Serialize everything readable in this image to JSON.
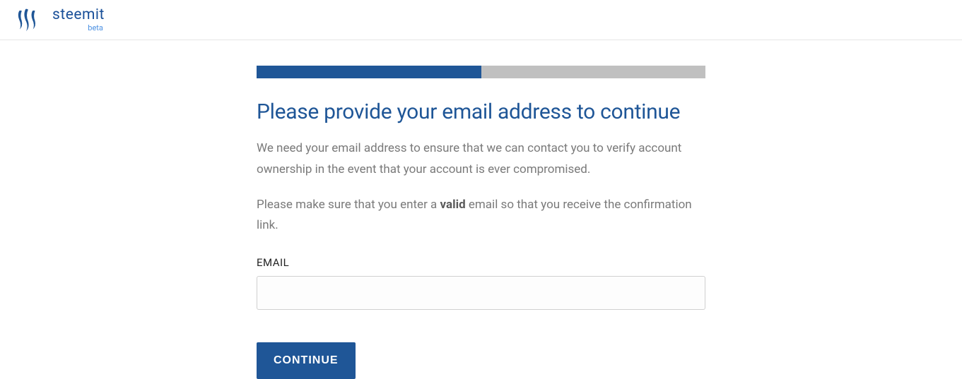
{
  "header": {
    "brand_name": "steemit",
    "brand_sub": "beta"
  },
  "progress": {
    "percent": 50
  },
  "form": {
    "title": "Please provide your email address to continue",
    "description_line1": "We need your email address to ensure that we can contact you to verify account ownership in the event that your account is ever compromised.",
    "description_line2_pre": "Please make sure that you enter a ",
    "description_line2_bold": "valid",
    "description_line2_post": " email so that you receive the confirmation link.",
    "email_label": "EMAIL",
    "email_value": "",
    "continue_label": "CONTINUE"
  },
  "colors": {
    "primary": "#1f5697",
    "progress_bg": "#c0c0c0",
    "text_muted": "#7a7a7a"
  }
}
